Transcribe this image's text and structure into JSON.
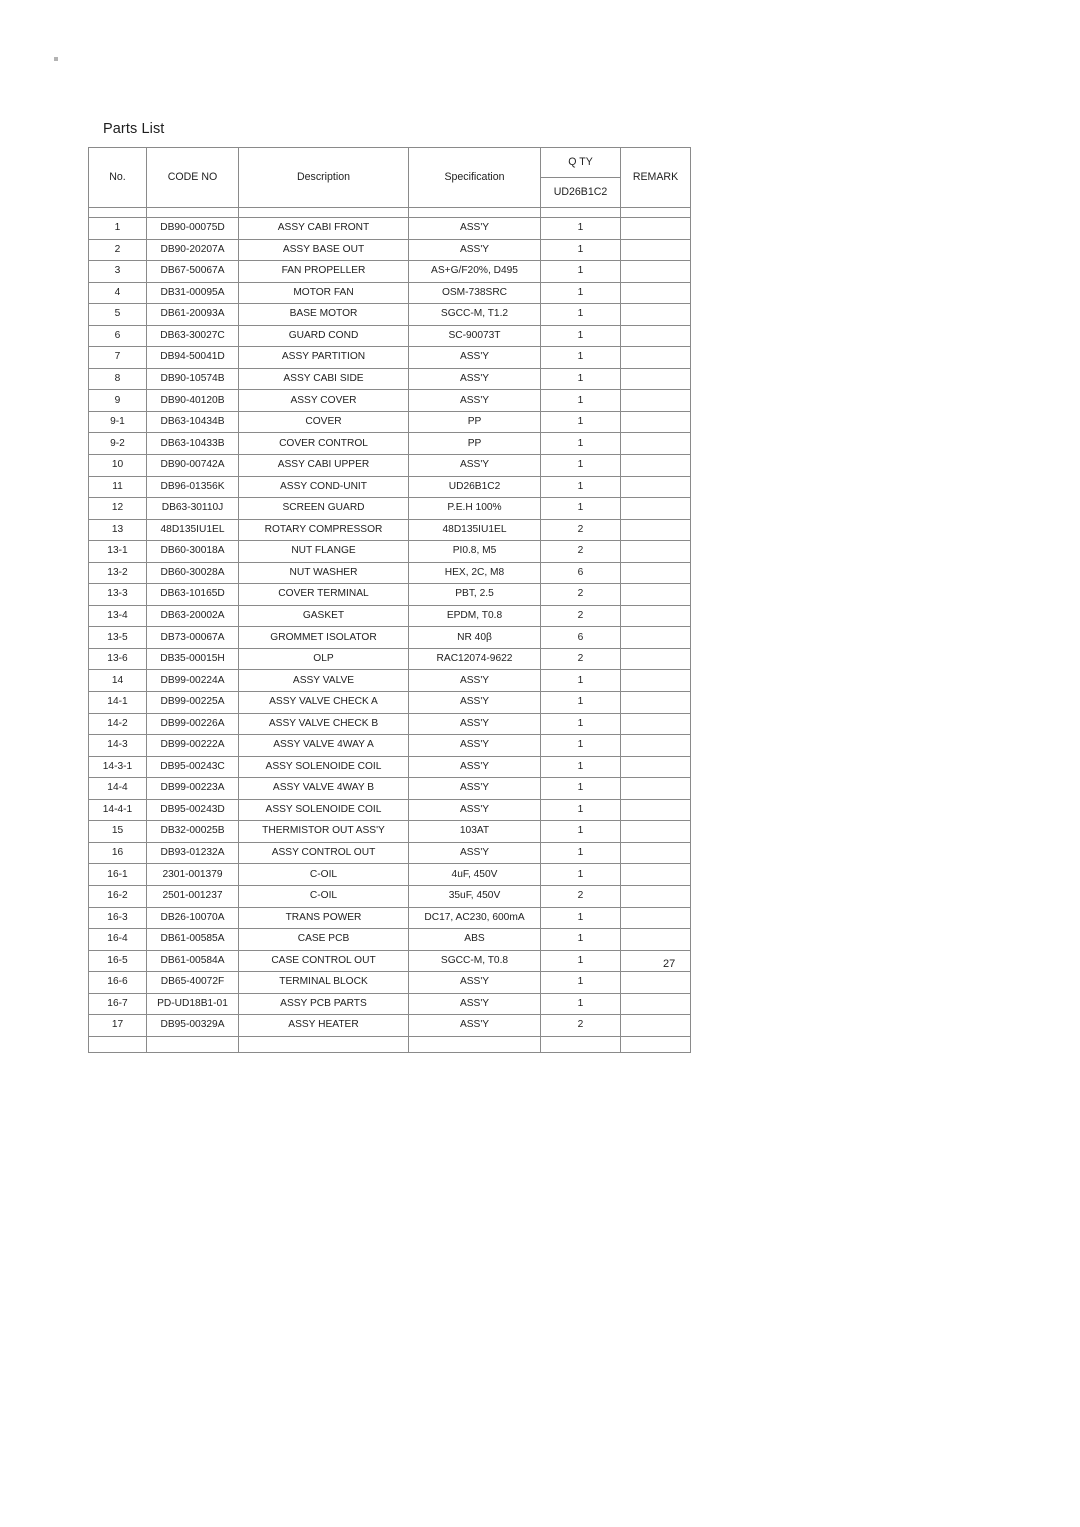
{
  "document": {
    "title": "Parts List",
    "page_number": "27"
  },
  "table": {
    "headers": {
      "no": "No.",
      "code_no": "CODE NO",
      "description": "Description",
      "specification": "Specification",
      "qty": "Q TY",
      "qty_model": "UD26B1C2",
      "remark": "REMARK"
    },
    "rows": [
      {
        "no": "1",
        "code": "DB90-00075D",
        "desc": "ASSY CABI FRONT",
        "spec": "ASS'Y",
        "qty": "1",
        "remark": ""
      },
      {
        "no": "2",
        "code": "DB90-20207A",
        "desc": "ASSY BASE OUT",
        "spec": "ASS'Y",
        "qty": "1",
        "remark": ""
      },
      {
        "no": "3",
        "code": "DB67-50067A",
        "desc": "FAN PROPELLER",
        "spec": "AS+G/F20%, D495",
        "qty": "1",
        "remark": ""
      },
      {
        "no": "4",
        "code": "DB31-00095A",
        "desc": "MOTOR FAN",
        "spec": "OSM-738SRC",
        "qty": "1",
        "remark": ""
      },
      {
        "no": "5",
        "code": "DB61-20093A",
        "desc": "BASE MOTOR",
        "spec": "SGCC-M, T1.2",
        "qty": "1",
        "remark": ""
      },
      {
        "no": "6",
        "code": "DB63-30027C",
        "desc": "GUARD COND",
        "spec": "SC-90073T",
        "qty": "1",
        "remark": ""
      },
      {
        "no": "7",
        "code": "DB94-50041D",
        "desc": "ASSY PARTITION",
        "spec": "ASS'Y",
        "qty": "1",
        "remark": ""
      },
      {
        "no": "8",
        "code": "DB90-10574B",
        "desc": "ASSY CABI SIDE",
        "spec": "ASS'Y",
        "qty": "1",
        "remark": ""
      },
      {
        "no": "9",
        "code": "DB90-40120B",
        "desc": "ASSY COVER",
        "spec": "ASS'Y",
        "qty": "1",
        "remark": ""
      },
      {
        "no": "9-1",
        "code": "DB63-10434B",
        "desc": "COVER",
        "spec": "PP",
        "qty": "1",
        "remark": ""
      },
      {
        "no": "9-2",
        "code": "DB63-10433B",
        "desc": "COVER CONTROL",
        "spec": "PP",
        "qty": "1",
        "remark": ""
      },
      {
        "no": "10",
        "code": "DB90-00742A",
        "desc": "ASSY CABI UPPER",
        "spec": "ASS'Y",
        "qty": "1",
        "remark": ""
      },
      {
        "no": "11",
        "code": "DB96-01356K",
        "desc": "ASSY COND-UNIT",
        "spec": "UD26B1C2",
        "qty": "1",
        "remark": ""
      },
      {
        "no": "12",
        "code": "DB63-30110J",
        "desc": "SCREEN GUARD",
        "spec": "P.E.H 100%",
        "qty": "1",
        "remark": ""
      },
      {
        "no": "13",
        "code": "48D135IU1EL",
        "desc": "ROTARY COMPRESSOR",
        "spec": "48D135IU1EL",
        "qty": "2",
        "remark": ""
      },
      {
        "no": "13-1",
        "code": "DB60-30018A",
        "desc": "NUT FLANGE",
        "spec": "PI0.8, M5",
        "qty": "2",
        "remark": ""
      },
      {
        "no": "13-2",
        "code": "DB60-30028A",
        "desc": "NUT WASHER",
        "spec": "HEX, 2C, M8",
        "qty": "6",
        "remark": ""
      },
      {
        "no": "13-3",
        "code": "DB63-10165D",
        "desc": "COVER TERMINAL",
        "spec": "PBT, 2.5",
        "qty": "2",
        "remark": ""
      },
      {
        "no": "13-4",
        "code": "DB63-20002A",
        "desc": "GASKET",
        "spec": "EPDM, T0.8",
        "qty": "2",
        "remark": ""
      },
      {
        "no": "13-5",
        "code": "DB73-00067A",
        "desc": "GROMMET ISOLATOR",
        "spec": "NR 40β",
        "qty": "6",
        "remark": ""
      },
      {
        "no": "13-6",
        "code": "DB35-00015H",
        "desc": "OLP",
        "spec": "RAC12074-9622",
        "qty": "2",
        "remark": ""
      },
      {
        "no": "14",
        "code": "DB99-00224A",
        "desc": "ASSY VALVE",
        "spec": "ASS'Y",
        "qty": "1",
        "remark": ""
      },
      {
        "no": "14-1",
        "code": "DB99-00225A",
        "desc": "ASSY VALVE CHECK A",
        "spec": "ASS'Y",
        "qty": "1",
        "remark": ""
      },
      {
        "no": "14-2",
        "code": "DB99-00226A",
        "desc": "ASSY VALVE CHECK B",
        "spec": "ASS'Y",
        "qty": "1",
        "remark": ""
      },
      {
        "no": "14-3",
        "code": "DB99-00222A",
        "desc": "ASSY VALVE 4WAY A",
        "spec": "ASS'Y",
        "qty": "1",
        "remark": ""
      },
      {
        "no": "14-3-1",
        "code": "DB95-00243C",
        "desc": "ASSY SOLENOIDE COIL",
        "spec": "ASS'Y",
        "qty": "1",
        "remark": ""
      },
      {
        "no": "14-4",
        "code": "DB99-00223A",
        "desc": "ASSY VALVE 4WAY B",
        "spec": "ASS'Y",
        "qty": "1",
        "remark": ""
      },
      {
        "no": "14-4-1",
        "code": "DB95-00243D",
        "desc": "ASSY SOLENOIDE COIL",
        "spec": "ASS'Y",
        "qty": "1",
        "remark": ""
      },
      {
        "no": "15",
        "code": "DB32-00025B",
        "desc": "THERMISTOR OUT ASS'Y",
        "spec": "103AT",
        "qty": "1",
        "remark": ""
      },
      {
        "no": "16",
        "code": "DB93-01232A",
        "desc": "ASSY CONTROL OUT",
        "spec": "ASS'Y",
        "qty": "1",
        "remark": ""
      },
      {
        "no": "16-1",
        "code": "2301-001379",
        "desc": "C-OIL",
        "spec": "4uF, 450V",
        "qty": "1",
        "remark": ""
      },
      {
        "no": "16-2",
        "code": "2501-001237",
        "desc": "C-OIL",
        "spec": "35uF, 450V",
        "qty": "2",
        "remark": ""
      },
      {
        "no": "16-3",
        "code": "DB26-10070A",
        "desc": "TRANS POWER",
        "spec": "DC17, AC230, 600mA",
        "qty": "1",
        "remark": ""
      },
      {
        "no": "16-4",
        "code": "DB61-00585A",
        "desc": "CASE PCB",
        "spec": "ABS",
        "qty": "1",
        "remark": ""
      },
      {
        "no": "16-5",
        "code": "DB61-00584A",
        "desc": "CASE CONTROL OUT",
        "spec": "SGCC-M, T0.8",
        "qty": "1",
        "remark": ""
      },
      {
        "no": "16-6",
        "code": "DB65-40072F",
        "desc": "TERMINAL BLOCK",
        "spec": "ASS'Y",
        "qty": "1",
        "remark": ""
      },
      {
        "no": "16-7",
        "code": "PD-UD18B1-01",
        "desc": "ASSY PCB PARTS",
        "spec": "ASS'Y",
        "qty": "1",
        "remark": ""
      },
      {
        "no": "17",
        "code": "DB95-00329A",
        "desc": "ASSY HEATER",
        "spec": "ASS'Y",
        "qty": "2",
        "remark": ""
      }
    ]
  }
}
